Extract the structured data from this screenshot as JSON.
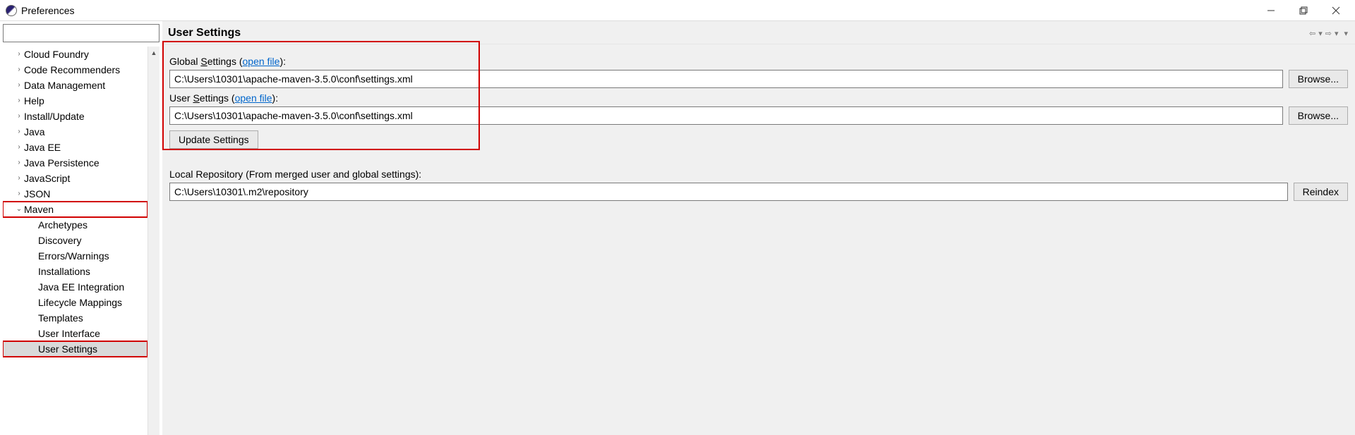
{
  "window": {
    "title": "Preferences"
  },
  "tree": {
    "items": [
      {
        "label": "Cloud Foundry",
        "expand": ">",
        "level": 1
      },
      {
        "label": "Code Recommenders",
        "expand": ">",
        "level": 1
      },
      {
        "label": "Data Management",
        "expand": ">",
        "level": 1
      },
      {
        "label": "Help",
        "expand": ">",
        "level": 1
      },
      {
        "label": "Install/Update",
        "expand": ">",
        "level": 1
      },
      {
        "label": "Java",
        "expand": ">",
        "level": 1
      },
      {
        "label": "Java EE",
        "expand": ">",
        "level": 1
      },
      {
        "label": "Java Persistence",
        "expand": ">",
        "level": 1
      },
      {
        "label": "JavaScript",
        "expand": ">",
        "level": 1
      },
      {
        "label": "JSON",
        "expand": ">",
        "level": 1
      },
      {
        "label": "Maven",
        "expand": "v",
        "level": 1,
        "red": true
      },
      {
        "label": "Archetypes",
        "expand": "",
        "level": 2
      },
      {
        "label": "Discovery",
        "expand": "",
        "level": 2
      },
      {
        "label": "Errors/Warnings",
        "expand": "",
        "level": 2
      },
      {
        "label": "Installations",
        "expand": "",
        "level": 2
      },
      {
        "label": "Java EE Integration",
        "expand": "",
        "level": 2
      },
      {
        "label": "Lifecycle Mappings",
        "expand": "",
        "level": 2
      },
      {
        "label": "Templates",
        "expand": "",
        "level": 2
      },
      {
        "label": "User Interface",
        "expand": "",
        "level": 2
      },
      {
        "label": "User Settings",
        "expand": "",
        "level": 2,
        "selected": true,
        "red": true
      }
    ]
  },
  "main": {
    "title": "User Settings",
    "global_label_pre": "Global ",
    "global_label_u": "S",
    "global_label_post": "ettings (",
    "open_file": "open file",
    "label_close": "):",
    "global_value": "C:\\Users\\10301\\apache-maven-3.5.0\\conf\\settings.xml",
    "browse": "Browse...",
    "user_label_pre": "User ",
    "user_label_u": "S",
    "user_label_post": "ettings (",
    "user_value": "C:\\Users\\10301\\apache-maven-3.5.0\\conf\\settings.xml",
    "update_btn": "Update Settings",
    "local_repo_label": "Local Repository (From merged user and global settings):",
    "local_repo_value": "C:\\Users\\10301\\.m2\\repository",
    "reindex": "Reindex"
  }
}
